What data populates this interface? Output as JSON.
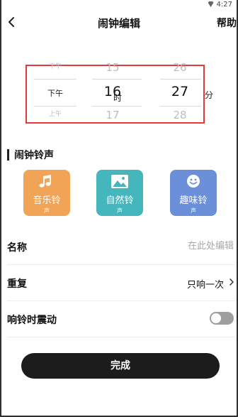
{
  "status": {
    "time": "4:27"
  },
  "header": {
    "title": "闹钟编辑",
    "help": "帮助"
  },
  "picker": {
    "prev": {
      "ampm": "下午",
      "hour": "15",
      "minute": "26"
    },
    "current": {
      "ampm": "下午",
      "hour": "16",
      "minute": "27"
    },
    "next": {
      "ampm": "上午",
      "hour": "17",
      "minute": "28"
    },
    "hour_unit": "时",
    "minute_unit": "分"
  },
  "ringtone_section": {
    "title": "闹钟铃声",
    "cards": [
      {
        "label": "音乐铃",
        "label2": "声",
        "icon": "music-note-icon",
        "color": "#f2a456"
      },
      {
        "label": "自然铃",
        "label2": "声",
        "icon": "landscape-icon",
        "color": "#45b6bc"
      },
      {
        "label": "趣味铃",
        "label2": "声",
        "icon": "smiley-icon",
        "color": "#6b8fd9"
      }
    ]
  },
  "settings": {
    "name": {
      "label": "名称",
      "placeholder": "在此处编辑"
    },
    "repeat": {
      "label": "重复",
      "value": "只响一次"
    },
    "vibrate": {
      "label": "响铃时震动",
      "on": false
    }
  },
  "done_button": {
    "label": "完成"
  }
}
